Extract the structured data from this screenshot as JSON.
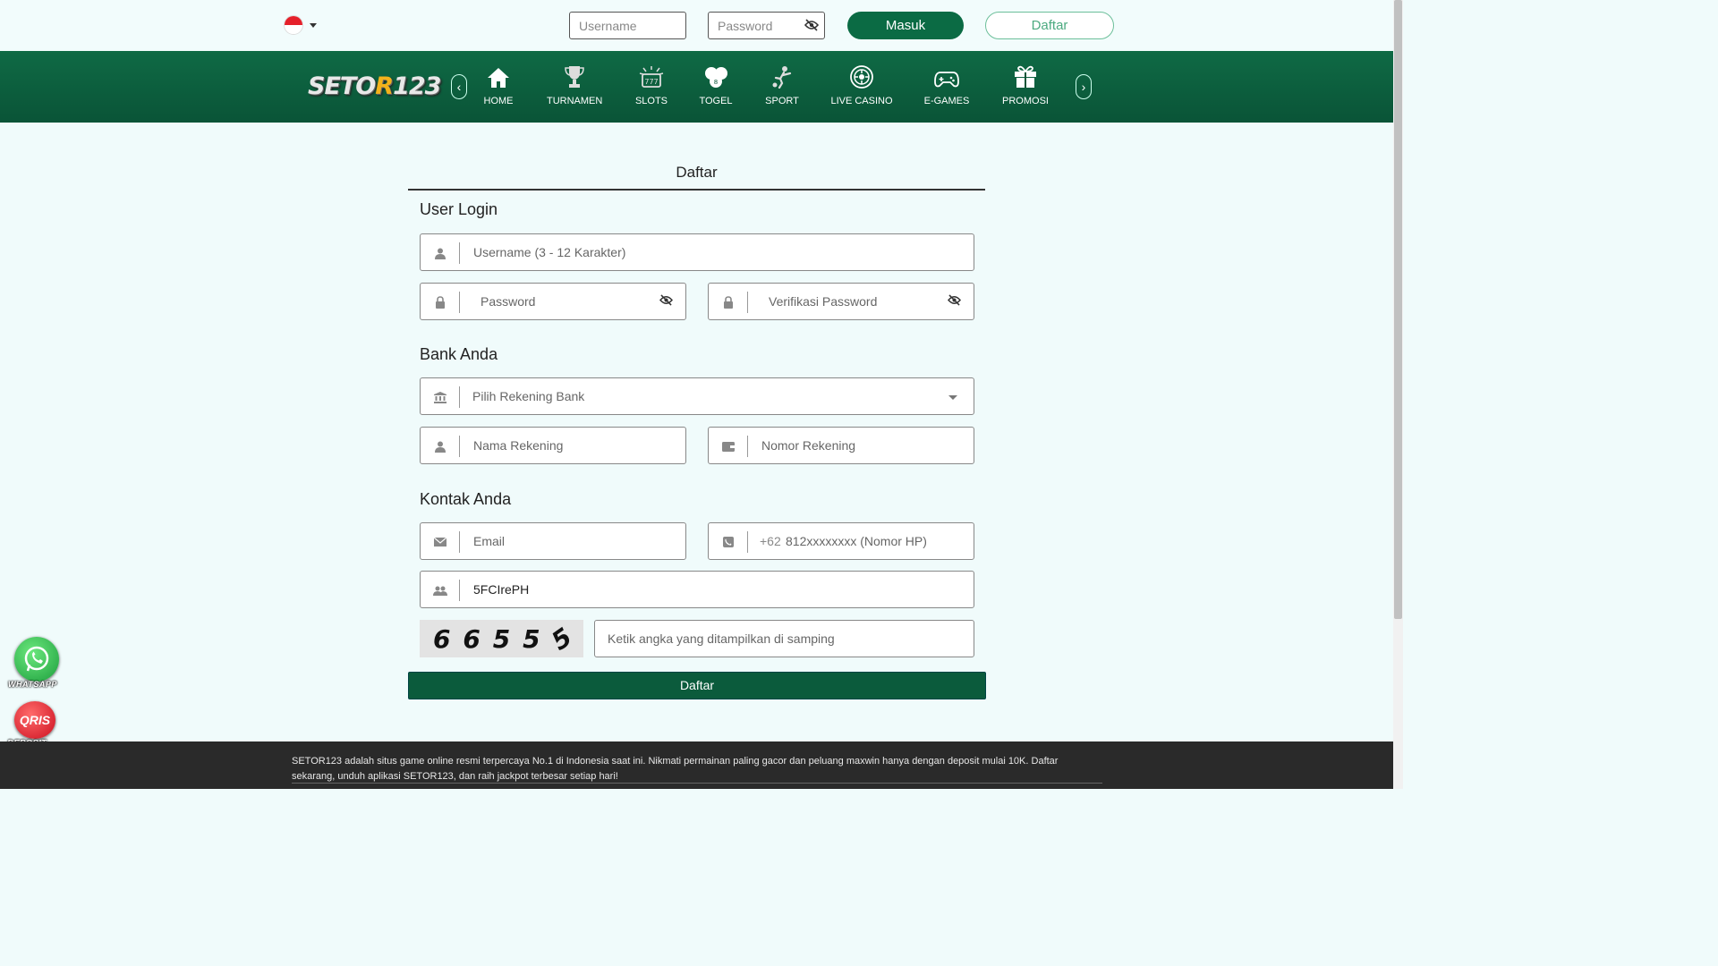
{
  "header": {
    "language_flag": "indonesia-flag",
    "username_placeholder": "Username",
    "password_placeholder": "Password",
    "login_label": "Masuk",
    "register_label": "Daftar"
  },
  "brand": {
    "logo_prefix": "SETO",
    "logo_o": "R",
    "logo_suffix": "123"
  },
  "nav": {
    "items": [
      {
        "label": "HOME",
        "icon": "home-icon"
      },
      {
        "label": "TURNAMEN",
        "icon": "trophy-icon"
      },
      {
        "label": "SLOTS",
        "icon": "slot-machine-icon"
      },
      {
        "label": "TOGEL",
        "icon": "lottery-balls-icon"
      },
      {
        "label": "SPORT",
        "icon": "soccer-player-icon"
      },
      {
        "label": "LIVE CASINO",
        "icon": "roulette-icon"
      },
      {
        "label": "E-GAMES",
        "icon": "gamepad-icon"
      },
      {
        "label": "PROMOSI",
        "icon": "gift-icon"
      }
    ]
  },
  "form": {
    "title": "Daftar",
    "section_login": "User Login",
    "username_placeholder": "Username (3 - 12  Karakter)",
    "password_placeholder": "Password",
    "verify_password_placeholder": "Verifikasi Password",
    "section_bank": "Bank Anda",
    "bank_select_placeholder": "Pilih Rekening Bank",
    "account_name_placeholder": "Nama Rekening",
    "account_number_placeholder": "Nomor Rekening",
    "section_contact": "Kontak Anda",
    "email_placeholder": "Email",
    "phone_prefix": "+62",
    "phone_placeholder": "812xxxxxxxx (Nomor HP)",
    "referral_value": "5FCIrePH",
    "captcha_digits": [
      "6",
      "6",
      "5",
      "5",
      "5"
    ],
    "captcha_placeholder": "Ketik angka yang ditampilkan di samping",
    "submit_label": "Daftar"
  },
  "floating": {
    "whatsapp_label": "WHATSAPP",
    "qris_text": "QRIS",
    "qris_label": "DEPOSIT"
  },
  "footer": {
    "text": "SETOR123 adalah situs game online resmi terpercaya No.1 di Indonesia saat ini. Nikmati permainan paling gacor dan peluang maxwin hanya dengan deposit mulai 10K. Daftar sekarang, unduh aplikasi SETOR123, dan raih jackpot terbesar setiap hari!"
  },
  "colors": {
    "brand_green": "#0b6b44",
    "nav_green": "#0a5437",
    "footer_bg": "#2a2a2a",
    "logo_gold": "#f3b21b"
  }
}
